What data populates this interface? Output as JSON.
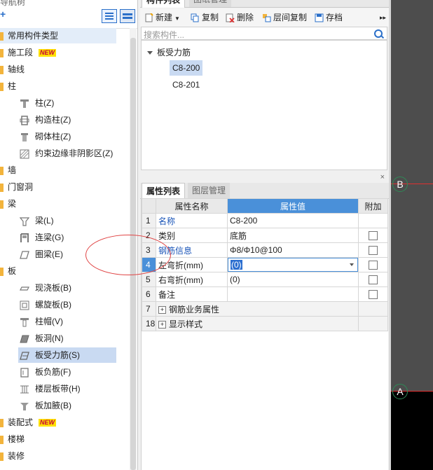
{
  "tree": {
    "title": "导航树",
    "categories": [
      {
        "label": "常用构件类型",
        "selected": true
      },
      {
        "label": "施工段",
        "badge": "NEW"
      },
      {
        "label": "轴线"
      },
      {
        "label": "柱"
      },
      {
        "label": "墙"
      },
      {
        "label": "门窗洞"
      },
      {
        "label": "梁"
      },
      {
        "label": "板"
      },
      {
        "label": "装配式",
        "badge": "NEW"
      },
      {
        "label": "楼梯"
      },
      {
        "label": "装修"
      }
    ],
    "column_items": [
      "柱(Z)",
      "构造柱(Z)",
      "砌体柱(Z)",
      "约束边缘非阴影区(Z)"
    ],
    "beam_items": [
      "梁(L)",
      "连梁(G)",
      "圈梁(E)"
    ],
    "slab_items": [
      "现浇板(B)",
      "螺旋板(B)",
      "柱帽(V)",
      "板洞(N)",
      "板受力筋(S)",
      "板负筋(F)",
      "楼层板带(H)",
      "板加腋(B)"
    ],
    "selected_slab_item": "板受力筋(S)"
  },
  "component_panel": {
    "tabs": [
      "构件列表",
      "图纸管理"
    ],
    "toolbar": {
      "new": "新建",
      "copy": "复制",
      "delete": "删除",
      "floor_copy": "层间复制",
      "archive": "存档",
      "more": "▸▸"
    },
    "search_placeholder": "搜索构件...",
    "group_label": "板受力筋",
    "items": [
      "C8-200",
      "C8-201"
    ],
    "selected_item": "C8-200"
  },
  "property_panel": {
    "tabs": [
      "属性列表",
      "图层管理"
    ],
    "headers": {
      "name": "属性名称",
      "value": "属性值",
      "extra": "附加"
    },
    "rows": [
      {
        "num": "1",
        "name": "名称",
        "value": "C8-200",
        "checkbox": false
      },
      {
        "num": "2",
        "name": "类别",
        "value": "底筋",
        "checkbox": true
      },
      {
        "num": "3",
        "name": "钢筋信息",
        "value": "Φ8/Φ10@100",
        "checkbox": true
      },
      {
        "num": "4",
        "name": "左弯折(mm)",
        "value": "(0)",
        "checkbox": true
      },
      {
        "num": "5",
        "name": "右弯折(mm)",
        "value": "(0)",
        "checkbox": true
      },
      {
        "num": "6",
        "name": "备注",
        "value": "",
        "checkbox": true
      },
      {
        "num": "7",
        "name": "钢筋业务属性",
        "value": "",
        "checkbox": false
      },
      {
        "num": "18",
        "name": "显示样式",
        "value": "",
        "checkbox": false
      }
    ],
    "expander_symbol": "+",
    "close_symbol": "×"
  },
  "canvas": {
    "axis_labels": [
      "B",
      "A"
    ]
  },
  "colors": {
    "accent": "#4a90d9",
    "selection": "#c9daf2",
    "new_badge_bg": "#ffe200",
    "folder": "#f3b43c",
    "annotation": "#e04545"
  }
}
